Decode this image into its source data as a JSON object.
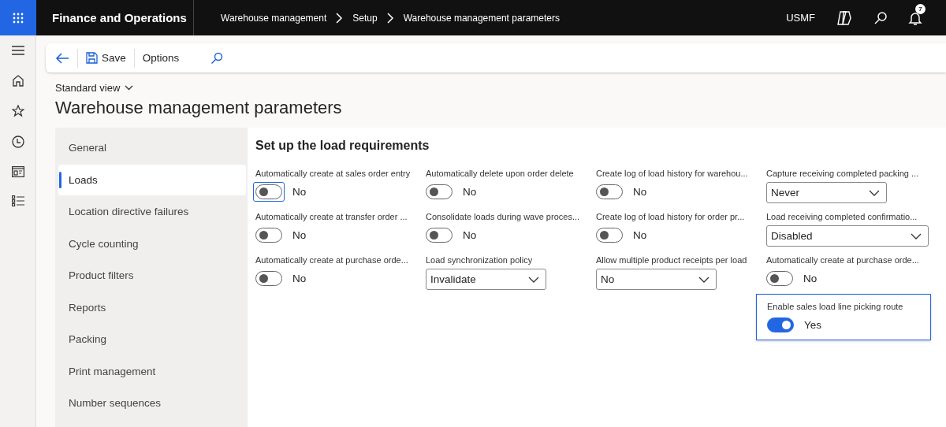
{
  "app": {
    "name": "Finance and Operations",
    "company": "USMF",
    "notifications": "7"
  },
  "breadcrumb": [
    "Warehouse management",
    "Setup",
    "Warehouse management parameters"
  ],
  "action_bar": {
    "buttons": [
      "Save",
      "Options"
    ]
  },
  "view": "Standard view",
  "page_title": "Warehouse management parameters",
  "nav": [
    {
      "label": "General",
      "selected": false
    },
    {
      "label": "Loads",
      "selected": true
    },
    {
      "label": "Location directive failures",
      "selected": false
    },
    {
      "label": "Cycle counting",
      "selected": false
    },
    {
      "label": "Product filters",
      "selected": false
    },
    {
      "label": "Reports",
      "selected": false
    },
    {
      "label": "Packing",
      "selected": false
    },
    {
      "label": "Print management",
      "selected": false
    },
    {
      "label": "Number sequences",
      "selected": false
    }
  ],
  "section_title": "Set up the load requirements",
  "columns": [
    [
      {
        "kind": "toggle",
        "label": "Automatically create at sales order entry",
        "on": false,
        "value": "No",
        "focused": true
      },
      {
        "kind": "toggle",
        "label": "Automatically create at transfer order ...",
        "on": false,
        "value": "No",
        "focused": false
      },
      {
        "kind": "toggle",
        "label": "Automatically create at purchase orde...",
        "on": false,
        "value": "No",
        "focused": false
      }
    ],
    [
      {
        "kind": "toggle",
        "label": "Automatically delete upon order delete",
        "on": false,
        "value": "No",
        "focused": false
      },
      {
        "kind": "toggle",
        "label": "Consolidate loads during wave proces...",
        "on": false,
        "value": "No",
        "focused": false
      },
      {
        "kind": "dropdown",
        "label": "Load synchronization policy",
        "value": "Invalidate",
        "focused": false
      }
    ],
    [
      {
        "kind": "toggle",
        "label": "Create log of load history for warehou...",
        "on": false,
        "value": "No",
        "focused": false
      },
      {
        "kind": "toggle",
        "label": "Create log of load history for order pr...",
        "on": false,
        "value": "No",
        "focused": false
      },
      {
        "kind": "dropdown",
        "label": "Allow multiple product receipts per load",
        "value": "No",
        "focused": false
      }
    ],
    [
      {
        "kind": "dropdown",
        "label": "Capture receiving completed packing ...",
        "value": "Never",
        "focused": false
      },
      {
        "kind": "dropdown",
        "label": "Load receiving completed confirmatio...",
        "value": "Disabled",
        "focused": false
      },
      {
        "kind": "toggle",
        "label": "Automatically create at purchase orde...",
        "on": false,
        "value": "No",
        "focused": false
      },
      {
        "kind": "toggle",
        "label": "Enable sales load line picking route",
        "on": true,
        "value": "Yes",
        "focused": true
      }
    ]
  ]
}
